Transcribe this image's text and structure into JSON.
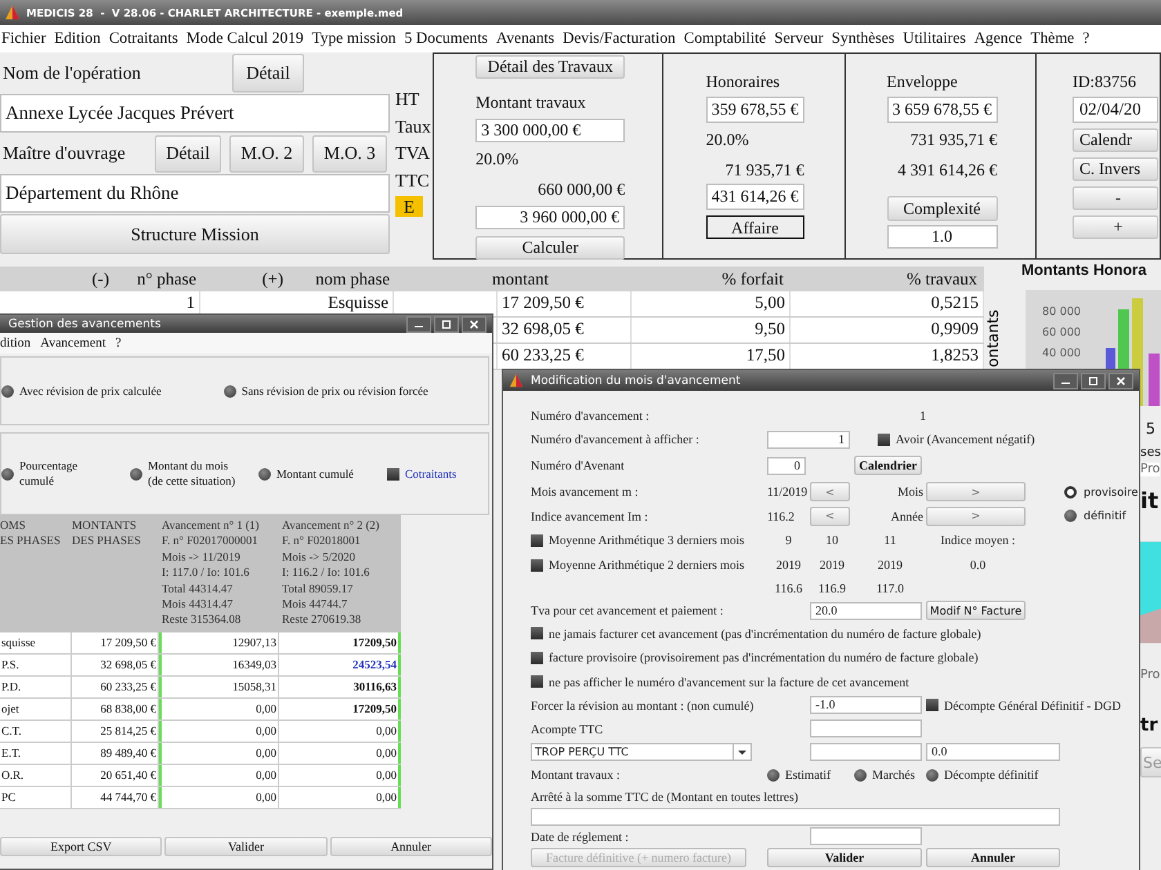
{
  "window": {
    "title": "MEDICIS 28  -  V 28.06 - CHARLET ARCHITECTURE - exemple.med"
  },
  "menu": [
    "Fichier",
    "Edition",
    "Cotraitants",
    "Mode Calcul 2019",
    "Type mission",
    "5 Documents",
    "Avenants",
    "Devis/Facturation",
    "Comptabilité",
    "Serveur",
    "Synthèses",
    "Utilitaires",
    "Agence",
    "Thème",
    "?"
  ],
  "operation": {
    "name_label": "Nom de l'opération",
    "detail_button": "Détail",
    "name_value": "Annexe Lycée Jacques Prévert",
    "owner_label": "Maître d'ouvrage",
    "owner_buttons": [
      "Détail",
      "M.O. 2",
      "M.O. 3"
    ],
    "owner_value": "Département du Rhône",
    "structure_button": "Structure Mission"
  },
  "row_labels": [
    "HT",
    "Taux",
    "TVA",
    "TTC"
  ],
  "e_badge": "E",
  "travaux": {
    "detail_button": "Détail des Travaux",
    "label": "Montant travaux",
    "ht": "3 300 000,00 €",
    "rate": "20.0%",
    "tva": "660 000,00 €",
    "ttc": "3 960 000,00 €",
    "calc_button": "Calculer"
  },
  "honoraires": {
    "label": "Honoraires",
    "ht": "359 678,55 €",
    "rate": "20.0%",
    "tva": "71 935,71 €",
    "ttc": "431 614,26 €",
    "affaire": "Affaire"
  },
  "enveloppe": {
    "label": "Enveloppe",
    "ht": "3 659 678,55 €",
    "tva": "731 935,71 €",
    "ttc": "4 391 614,26 €",
    "complexity_button": "Complexité",
    "complexity": "1.0"
  },
  "dossier": {
    "id": "ID:83756",
    "date": "02/04/20",
    "calendar_button": "Calendr",
    "inverse_button": "C. Invers",
    "minus_button": "-",
    "plus_button": "+"
  },
  "phases": {
    "columns": [
      "(-)",
      "n° phase",
      "(+)",
      "nom phase",
      "montant",
      "% forfait",
      "% travaux"
    ],
    "rows": [
      {
        "number": "1",
        "name": "Esquisse",
        "amount": "17 209,50 €",
        "forfait": "5,00",
        "travaux": "0,5215"
      },
      {
        "amount": "32 698,05 €",
        "forfait": "9,50",
        "travaux": "0,9909"
      },
      {
        "amount": "60 233,25 €",
        "forfait": "17,50",
        "travaux": "1,8253"
      }
    ]
  },
  "side_chart": {
    "title": "Montants Honora",
    "ylabel": "ontants",
    "ticks": [
      "80 000",
      "60 000",
      "40 000"
    ]
  },
  "side_fragments": {
    "legend_number": "5",
    "tab_text": "ses",
    "label_1": "Pro",
    "chart_title": "it",
    "label_2": "Pro",
    "section_title": "tr",
    "button": "Se"
  },
  "progress_window": {
    "title": "Gestion des avancements",
    "menu": [
      "dition",
      "Avancement",
      "?"
    ],
    "revision_options": [
      {
        "label": "Avec révision de prix calculée",
        "selected": false
      },
      {
        "label": "Sans révision de prix ou révision forcée",
        "selected": false
      }
    ],
    "display_options": [
      {
        "label": "Pourcentage cumulé",
        "selected": false
      },
      {
        "label": "Montant du mois (de cette situation)",
        "selected": false
      },
      {
        "label": "Montant cumulé",
        "selected": false
      }
    ],
    "cotraitants": {
      "label": "Cotraitants",
      "checked": false
    },
    "columns": [
      {
        "lines": [
          "OMS",
          "ES PHASES"
        ]
      },
      {
        "lines": [
          "MONTANTS",
          "DES PHASES"
        ]
      },
      {
        "lines": [
          "Avancement n° 1 (1)",
          "F. n° F02017000001",
          "Mois -> 11/2019",
          "I: 117.0 / Io: 101.6",
          "Total 44314.47",
          "Mois 44314.47",
          "Reste 315364.08"
        ]
      },
      {
        "lines": [
          "Avancement n° 2 (2)",
          "F. n° F02018001",
          "Mois -> 5/2020",
          "I: 116.2 / Io: 101.6",
          "Total 89059.17",
          "Mois 44744.7",
          "Reste 270619.38"
        ]
      }
    ],
    "rows": [
      {
        "name": "squisse",
        "amount": "17 209,50 €",
        "values": [
          {
            "text": "12907,13",
            "kind": "plain"
          },
          {
            "text": "17209,50",
            "kind": "bold"
          }
        ]
      },
      {
        "name": "P.S.",
        "amount": "32 698,05 €",
        "values": [
          {
            "text": "16349,03",
            "kind": "plain"
          },
          {
            "text": "24523,54",
            "kind": "highlight"
          }
        ]
      },
      {
        "name": "P.D.",
        "amount": "60 233,25 €",
        "values": [
          {
            "text": "15058,31",
            "kind": "plain"
          },
          {
            "text": "30116,63",
            "kind": "bold"
          }
        ]
      },
      {
        "name": "ojet",
        "amount": "68 838,00 €",
        "values": [
          {
            "text": "0,00",
            "kind": "plain"
          },
          {
            "text": "17209,50",
            "kind": "bold"
          }
        ]
      },
      {
        "name": "C.T.",
        "amount": "25 814,25 €",
        "values": [
          {
            "text": "0,00",
            "kind": "plain"
          },
          {
            "text": "0,00",
            "kind": "plain"
          }
        ]
      },
      {
        "name": "E.T.",
        "amount": "89 489,40 €",
        "values": [
          {
            "text": "0,00",
            "kind": "plain"
          },
          {
            "text": "0,00",
            "kind": "plain"
          }
        ]
      },
      {
        "name": "O.R.",
        "amount": "20 651,40 €",
        "values": [
          {
            "text": "0,00",
            "kind": "plain"
          },
          {
            "text": "0,00",
            "kind": "plain"
          }
        ]
      },
      {
        "name": "PC",
        "amount": "44 744,70 €",
        "values": [
          {
            "text": "0,00",
            "kind": "plain"
          },
          {
            "text": "0,00",
            "kind": "plain"
          }
        ]
      }
    ],
    "buttons": [
      "Export CSV",
      "Valider",
      "Annuler"
    ]
  },
  "modal": {
    "title": "Modification du mois d'avancement",
    "advance_number_label": "Numéro d'avancement :",
    "advance_number": "1",
    "display_number_label": "Numéro d'avancement à afficher :",
    "display_number": "1",
    "credit": {
      "label": "Avoir (Avancement négatif)",
      "checked": false
    },
    "amendment_label": "Numéro d'Avenant",
    "amendment": "0",
    "calendar_button": "Calendrier",
    "month_label": "Mois avancement m :",
    "month": "11/2019",
    "prev_month_button": "<",
    "month_nav_label": "Mois",
    "next_month_button": ">",
    "index_label": "Indice avancement Im :",
    "index": "116.2",
    "prev_year_button": "<",
    "year_nav_label": "Année",
    "next_year_button": ">",
    "status_options": [
      {
        "label": "provisoire",
        "selected": true
      },
      {
        "label": "définitif",
        "selected": false
      }
    ],
    "average_options": [
      {
        "label": "Moyenne Arithmétique 3 derniers mois",
        "checked": false
      },
      {
        "label": "Moyenne Arithmétique 2 derniers mois",
        "checked": false
      }
    ],
    "average_months": [
      "9",
      "10",
      "11"
    ],
    "average_years": [
      "2019",
      "2019",
      "2019"
    ],
    "average_indices": [
      "116.6",
      "116.9",
      "117.0"
    ],
    "average_label": "Indice moyen :",
    "average_value": "0.0",
    "vat_label": "Tva pour cet avancement et paiement :",
    "vat": "20.0",
    "invoice_number_button": "Modif N° Facture",
    "invoice_options": [
      {
        "label": "ne jamais facturer cet avancement (pas d'incrémentation du numéro de facture globale)",
        "checked": false
      },
      {
        "label": "facture provisoire (provisoirement pas d'incrémentation du numéro de facture globale)",
        "checked": false
      },
      {
        "label": "ne pas afficher le numéro d'avancement sur la facture de cet avancement",
        "checked": false
      }
    ],
    "forced_revision_label": "Forcer la révision au montant : (non cumulé)",
    "forced_revision": "-1.0",
    "dgd": {
      "label": "Décompte Général Définitif - DGD",
      "checked": false
    },
    "deposit_label": "Acompte TTC",
    "overpaid_select": "TROP PERÇU TTC",
    "overpaid_value": "0.0",
    "works_amount_label": "Montant travaux :",
    "works_amount_options": [
      {
        "label": "Estimatif",
        "selected": false
      },
      {
        "label": "Marchés",
        "selected": false
      },
      {
        "label": "Décompte définitif",
        "selected": false
      }
    ],
    "words_label": "Arrêté à la somme TTC de (Montant en toutes lettres)",
    "payment_date_label": "Date de réglement :",
    "final_invoice_button": {
      "label": "Facture définitive (+ numero facture)",
      "disabled": true
    },
    "buttons": [
      "Valider",
      "Annuler"
    ]
  }
}
